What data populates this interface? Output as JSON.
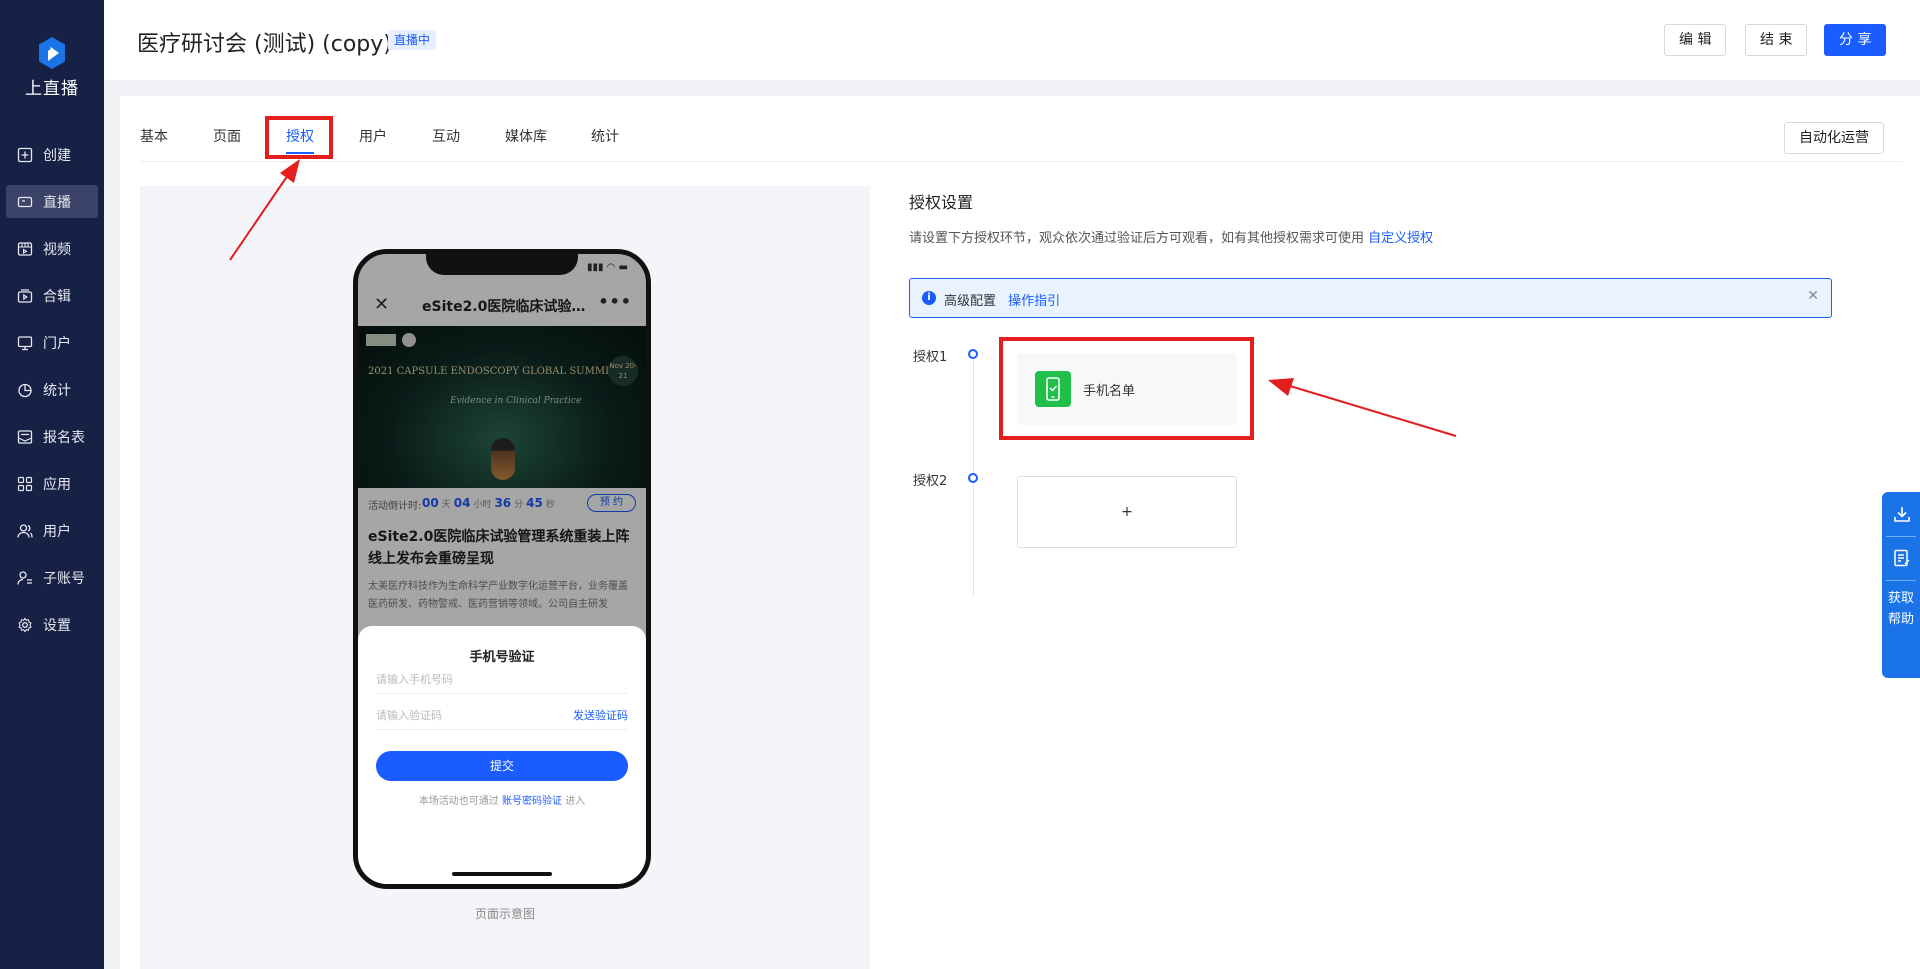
{
  "app": {
    "logo_text": "上直播"
  },
  "sidebar": {
    "items": [
      {
        "label": "创建",
        "icon": "plus-square-icon"
      },
      {
        "label": "直播",
        "icon": "video-camera-icon",
        "active": true
      },
      {
        "label": "视频",
        "icon": "film-icon"
      },
      {
        "label": "合辑",
        "icon": "collection-icon"
      },
      {
        "label": "门户",
        "icon": "monitor-icon"
      },
      {
        "label": "统计",
        "icon": "pie-chart-icon"
      },
      {
        "label": "报名表",
        "icon": "form-icon"
      },
      {
        "label": "应用",
        "icon": "apps-icon"
      },
      {
        "label": "用户",
        "icon": "users-icon"
      },
      {
        "label": "子账号",
        "icon": "sub-account-icon"
      },
      {
        "label": "设置",
        "icon": "gear-icon"
      }
    ]
  },
  "header": {
    "title": "医疗研讨会 (测试) (copy)",
    "status_badge": "直播中",
    "edit_label": "编 辑",
    "end_label": "结 束",
    "share_label": "分 享"
  },
  "tabs": {
    "items": [
      "基本",
      "页面",
      "授权",
      "用户",
      "互动",
      "媒体库",
      "统计"
    ],
    "active": "授权",
    "automation_label": "自动化运营"
  },
  "preview": {
    "caption": "页面示意图",
    "phone": {
      "title": "eSite2.0医院临床试验管...",
      "banner_line": "2021 CAPSULE ENDOSCOPY GLOBAL SUMMIT",
      "banner_tag": "Evidence in Clinical Practice",
      "banner_date": "Nov 20-21",
      "countdown_label": "活动倒计时:",
      "countdown": {
        "days": "00",
        "hours": "04",
        "minutes": "36",
        "seconds": "45"
      },
      "countdown_units": {
        "days": "天",
        "hours": "小时",
        "minutes": "分",
        "seconds": "秒"
      },
      "reserve_label": "预 约",
      "article_title": "eSite2.0医院临床试验管理系统重装上阵线上发布会重磅呈现",
      "article_body": "太美医疗科技作为生命科学产业数字化运营平台，业务覆盖医药研发、药物警戒、医药营销等领域。公司自主研发",
      "sheet": {
        "title": "手机号验证",
        "phone_placeholder": "请输入手机号码",
        "code_placeholder": "请输入验证码",
        "send_code": "发送验证码",
        "submit": "提交",
        "foot_prefix": "本场活动也可通过",
        "foot_link": "账号密码验证",
        "foot_suffix": "进入"
      }
    }
  },
  "auth": {
    "title": "授权设置",
    "desc": "请设置下方授权环节，观众依次通过验证后方可观看，如有其他授权需求可使用",
    "desc_link": "自定义授权",
    "info_label": "高级配置",
    "info_link": "操作指引",
    "steps": [
      {
        "label": "授权1",
        "card": "手机名单"
      },
      {
        "label": "授权2",
        "card": "+"
      }
    ]
  },
  "float_help": {
    "label": "获取帮助"
  },
  "colors": {
    "sidebar_bg": "#172045",
    "accent": "#1a5cff",
    "annotation_red": "#e41d1d"
  }
}
